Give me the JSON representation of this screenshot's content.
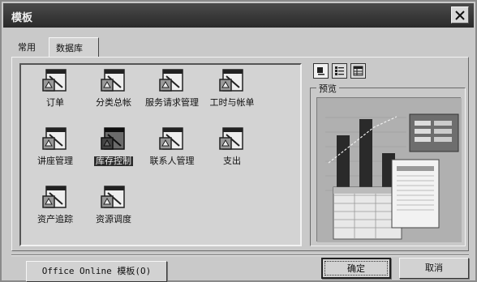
{
  "window": {
    "title": "模板"
  },
  "tabs": [
    {
      "label": "常用"
    },
    {
      "label": "数据库"
    }
  ],
  "templates": [
    {
      "label": "订单",
      "selected": false
    },
    {
      "label": "分类总帐",
      "selected": false
    },
    {
      "label": "服务请求管理",
      "selected": false
    },
    {
      "label": "工时与帐单",
      "selected": false
    },
    {
      "label": "讲座管理",
      "selected": false
    },
    {
      "label": "库存控制",
      "selected": true
    },
    {
      "label": "联系人管理",
      "selected": false
    },
    {
      "label": "支出",
      "selected": false
    },
    {
      "label": "资产追踪",
      "selected": false
    },
    {
      "label": "资源调度",
      "selected": false
    }
  ],
  "view_buttons": [
    {
      "icon": "large-icons-view-icon"
    },
    {
      "icon": "list-view-icon"
    },
    {
      "icon": "details-view-icon"
    }
  ],
  "preview": {
    "label": "预览",
    "bars": [
      0.72,
      0.92,
      0.5
    ],
    "line": [
      0.38,
      0.6,
      0.82,
      0.95
    ]
  },
  "buttons": {
    "online": "Office Online 模板(O)",
    "ok": "确定",
    "cancel": "取消"
  },
  "colors": {
    "selection": "#2d2d2d",
    "dialog": "#c9c9c9"
  }
}
